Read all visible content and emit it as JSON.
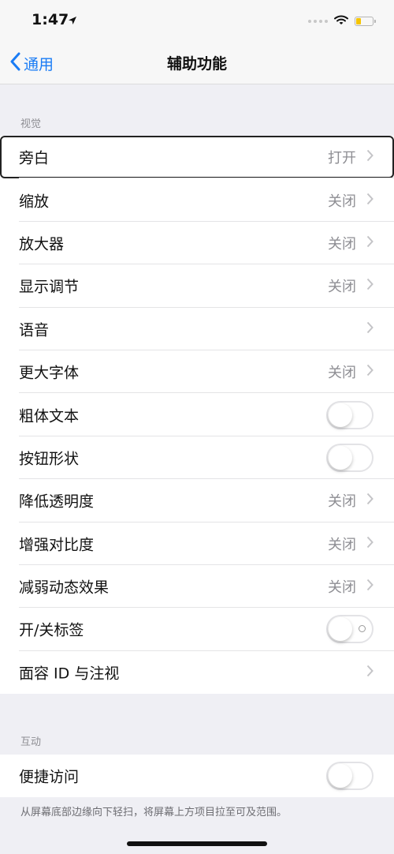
{
  "status": {
    "time": "1:47"
  },
  "nav": {
    "back_label": "通用",
    "title": "辅助功能"
  },
  "sections": {
    "vision_header": "视觉",
    "interaction_header": "互动"
  },
  "vision_rows": [
    {
      "label": "旁白",
      "value": "打开"
    },
    {
      "label": "缩放",
      "value": "关闭"
    },
    {
      "label": "放大器",
      "value": "关闭"
    },
    {
      "label": "显示调节",
      "value": "关闭"
    },
    {
      "label": "语音",
      "value": ""
    },
    {
      "label": "更大字体",
      "value": "关闭"
    },
    {
      "label": "粗体文本",
      "toggle": false
    },
    {
      "label": "按钮形状",
      "toggle": false
    },
    {
      "label": "降低透明度",
      "value": "关闭"
    },
    {
      "label": "增强对比度",
      "value": "关闭"
    },
    {
      "label": "减弱动态效果",
      "value": "关闭"
    },
    {
      "label": "开/关标签",
      "toggle": false
    },
    {
      "label": "面容 ID 与注视",
      "value": ""
    }
  ],
  "interaction_rows": [
    {
      "label": "便捷访问",
      "toggle": false
    }
  ],
  "footer_note": "从屏幕底部边缘向下轻扫，将屏幕上方项目拉至可及范围。",
  "colors": {
    "accent": "#1a7cf5",
    "battery": "#f5c400",
    "background": "#efeff4"
  },
  "icons": {
    "back": "chevron-left-icon",
    "row": "chevron-right-icon",
    "wifi": "wifi-icon",
    "battery": "battery-icon",
    "location": "location-arrow-icon"
  }
}
